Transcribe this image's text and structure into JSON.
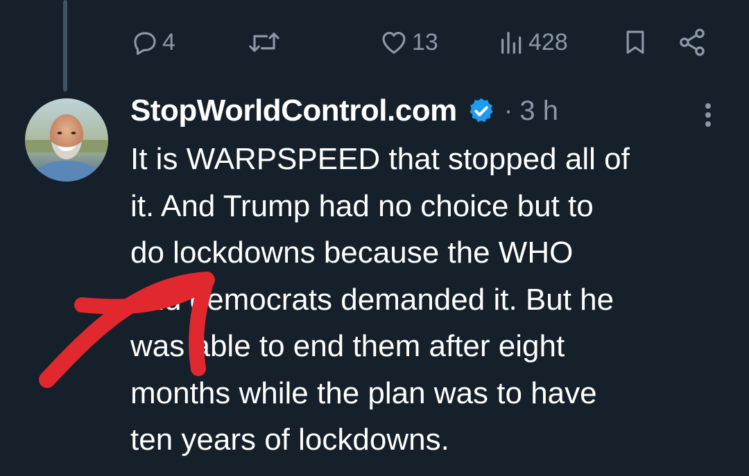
{
  "previous_tweet": {
    "actions": {
      "reply_count": "4",
      "retweet_count": "",
      "like_count": "13",
      "view_count": "428"
    }
  },
  "tweet": {
    "display_name": "StopWorldControl.com",
    "separator": "·",
    "timestamp": "3 h",
    "lines": [
      "It is WARPSPEED that stopped all of",
      "it. And Trump had no choice but to",
      "do lockdowns because the WHO",
      "and democrats demanded it. But he",
      "was able to end them after eight",
      "months while the plan was to have",
      "ten years of lockdowns."
    ]
  },
  "icons": {
    "reply": "reply-icon",
    "retweet": "retweet-icon",
    "like": "heart-icon",
    "views": "views-icon",
    "bookmark": "bookmark-icon",
    "share": "share-icon",
    "verified": "verified-badge-icon",
    "more": "more-options-icon"
  },
  "colors": {
    "background": "#15202b",
    "muted_text": "#8b98a5",
    "verified_blue": "#1d9bf0",
    "annotation_red": "#e0282e"
  }
}
